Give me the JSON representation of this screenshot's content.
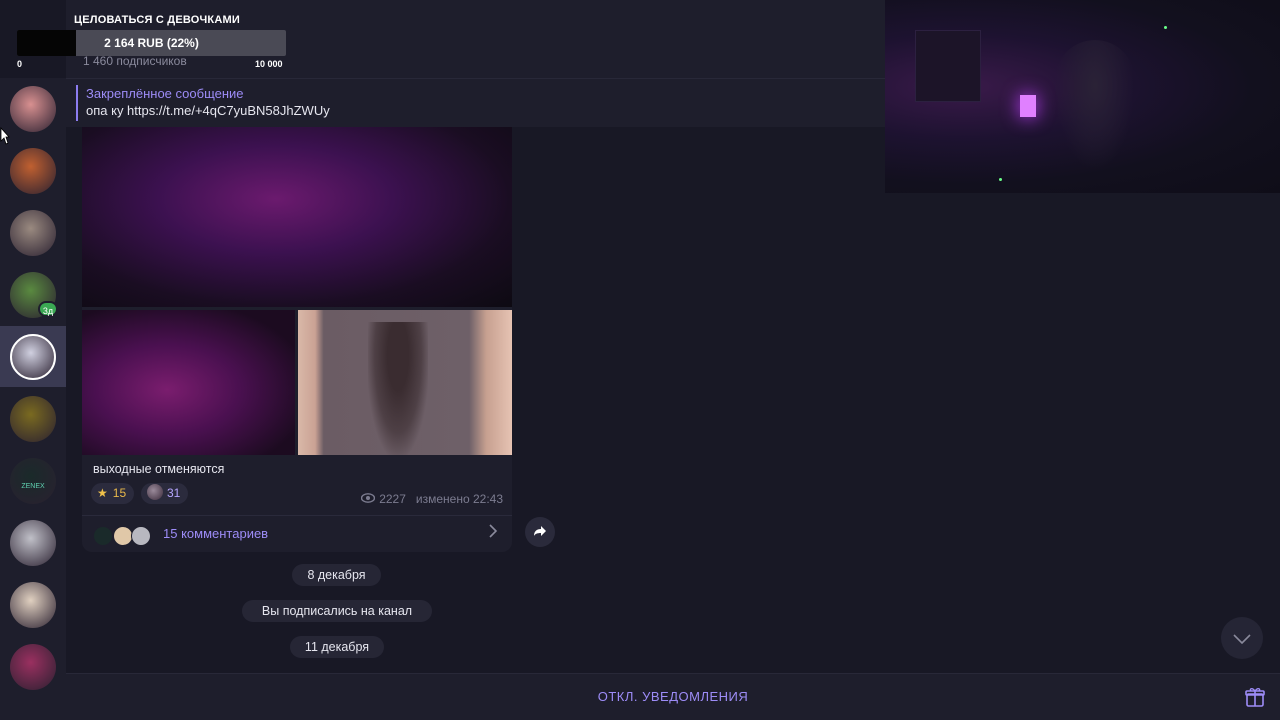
{
  "overlay": {
    "title": "ЦЕЛОВАТЬСЯ С ДЕВОЧКАМИ",
    "amount": "2 164 RUB (22%)",
    "progress": 0.22,
    "min": "0",
    "max": "10 000"
  },
  "channel": {
    "subscribers": "1 460 подписчиков"
  },
  "pinned": {
    "title": "Закреплённое сообщение",
    "text": "опа ку https://t.me/+4qC7yuBN58JhZWUy"
  },
  "sidebar": {
    "badge": "3д",
    "avatars": [
      {
        "name": "avatar-1",
        "color": "#d89090"
      },
      {
        "name": "avatar-2",
        "color": "#c06030"
      },
      {
        "name": "avatar-3",
        "color": "#9a8a80"
      },
      {
        "name": "avatar-4",
        "color": "#5a8a40"
      },
      {
        "name": "avatar-5",
        "color": "#d0d0e0"
      },
      {
        "name": "avatar-6",
        "color": "#7a6a20"
      },
      {
        "name": "avatar-7",
        "color": "#1a2a2a",
        "label": "ZENEX"
      },
      {
        "name": "avatar-8",
        "color": "#c0c0c8"
      },
      {
        "name": "avatar-9",
        "color": "#e0d0c0"
      },
      {
        "name": "avatar-10",
        "color": "#9a3060"
      }
    ]
  },
  "post": {
    "caption": "выходные отменяются",
    "reactions": [
      {
        "icon": "star-icon",
        "count": "15"
      },
      {
        "icon": "avatar-reaction",
        "count": "31"
      }
    ],
    "views": "2227",
    "edited": "изменено 22:43",
    "comments_label": "15 комментариев"
  },
  "service": {
    "date1": "8 декабря",
    "subscribed": "Вы подписались на канал",
    "date2": "11 декабря"
  },
  "bottom": {
    "mute_label": "ОТКЛ. УВЕДОМЛЕНИЯ"
  },
  "colors": {
    "accent": "#9d8cf7",
    "background": "#181825",
    "panel": "#1e1e2c"
  }
}
